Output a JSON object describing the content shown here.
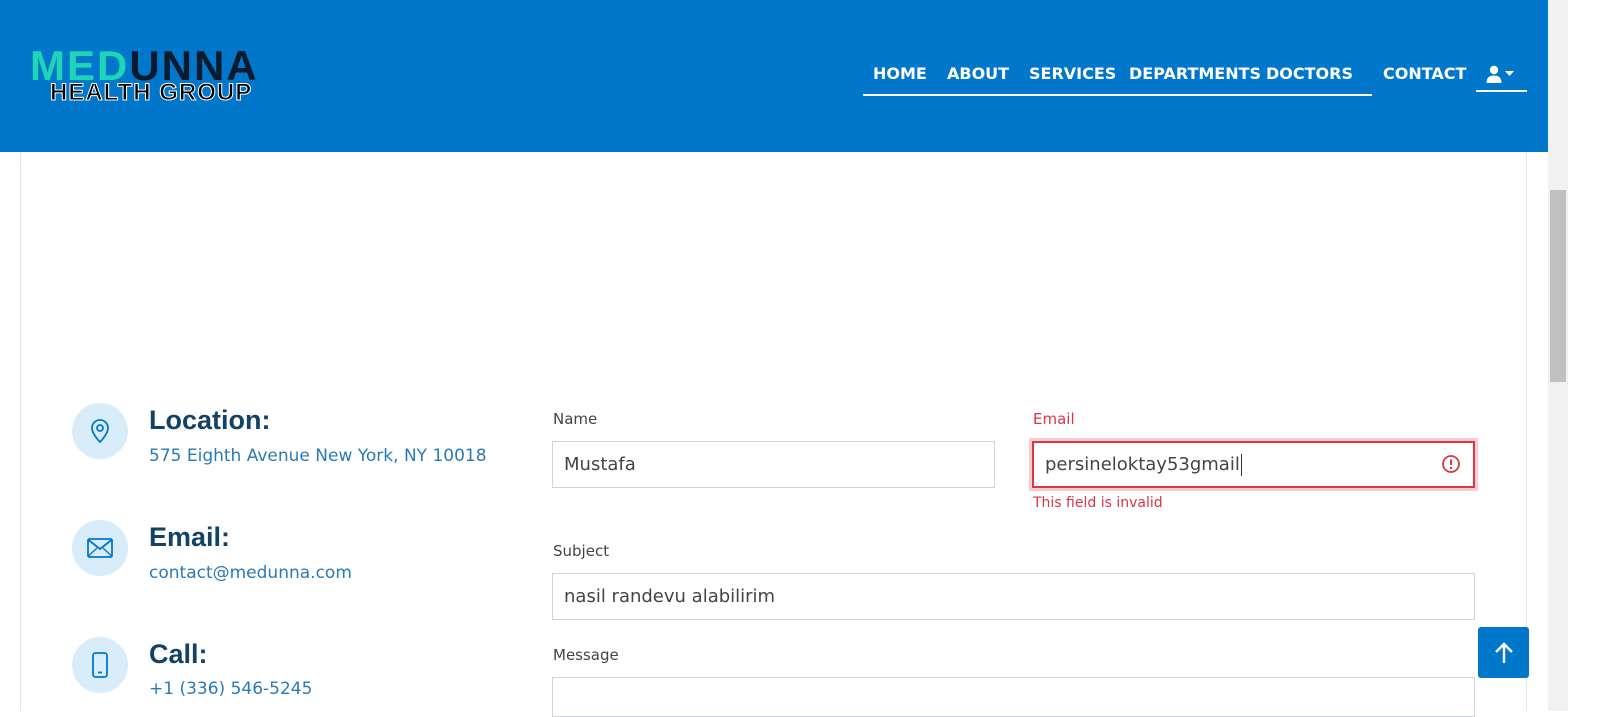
{
  "brand": {
    "logo_primary": "MED",
    "logo_secondary": "UNNA",
    "logo_sub": "HEALTH GROUP"
  },
  "nav": {
    "items": [
      "HOME",
      "ABOUT",
      "SERVICES",
      "DEPARTMENTS",
      "DOCTORS",
      "CONTACT"
    ],
    "user_icon": "user-icon",
    "colors": {
      "bar": "#0077cb",
      "text": "#ffffff"
    }
  },
  "info": {
    "location": {
      "title": "Location:",
      "text": "575 Eighth Avenue New York, NY 10018",
      "icon": "map-pin-icon"
    },
    "email": {
      "title": "Email:",
      "text": "contact@medunna.com",
      "icon": "envelope-icon"
    },
    "call": {
      "title": "Call:",
      "text": "+1 (336) 546-5245",
      "icon": "phone-icon"
    }
  },
  "form": {
    "name": {
      "label": "Name",
      "value": "Mustafa"
    },
    "email": {
      "label": "Email",
      "value": "persineloktay53gmail",
      "error": "This field is invalid"
    },
    "subject": {
      "label": "Subject",
      "value": "nasil randevu alabilirim"
    },
    "message": {
      "label": "Message"
    }
  },
  "colors": {
    "accent": "#0077cb",
    "error": "#dc3545",
    "title": "#124265",
    "link": "#2a7ab8"
  }
}
